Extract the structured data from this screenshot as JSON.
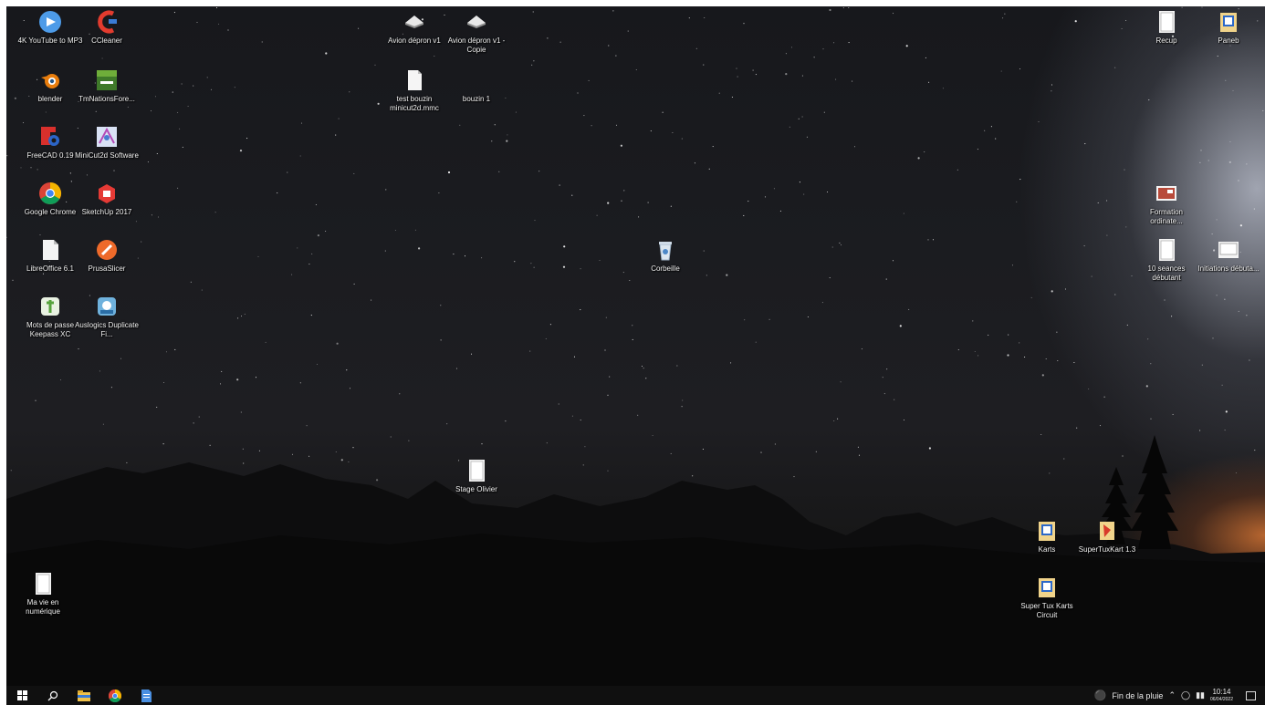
{
  "desktop": {
    "icons": [
      {
        "label": "4K YouTube to MP3",
        "icon": "youtube-mp3-icon"
      },
      {
        "label": "CCleaner",
        "icon": "ccleaner-icon"
      },
      {
        "label": "blender",
        "icon": "blender-icon"
      },
      {
        "label": "TmNationsFore...",
        "icon": "trackmania-icon"
      },
      {
        "label": "FreeCAD 0.19",
        "icon": "freecad-icon"
      },
      {
        "label": "MiniCut2d Software",
        "icon": "minicut2d-icon"
      },
      {
        "label": "Google Chrome",
        "icon": "chrome-icon"
      },
      {
        "label": "SketchUp 2017",
        "icon": "sketchup-icon"
      },
      {
        "label": "LibreOffice 6.1",
        "icon": "libreoffice-icon"
      },
      {
        "label": "PrusaSlicer",
        "icon": "prusaslicer-icon"
      },
      {
        "label": "Mots de passe Keepass XC",
        "icon": "keepassxc-icon"
      },
      {
        "label": "Auslogics Duplicate Fi...",
        "icon": "auslogics-icon"
      },
      {
        "label": "Avion dépron v1",
        "icon": "dxf-file-icon"
      },
      {
        "label": "Avion dépron v1 - Copie",
        "icon": "dxf-file-icon"
      },
      {
        "label": "test bouzin minicut2d.mmc",
        "icon": "file-icon"
      },
      {
        "label": "bouzin 1",
        "icon": "blank-icon"
      },
      {
        "label": "Corbeille",
        "icon": "recycle-bin-icon"
      },
      {
        "label": "Stage Olivier",
        "icon": "document-icon"
      },
      {
        "label": "Ma vie en numérique",
        "icon": "document-icon"
      },
      {
        "label": "Recup",
        "icon": "document-icon"
      },
      {
        "label": "Paneb",
        "icon": "folder-doc-icon"
      },
      {
        "label": "Formation ordinate...",
        "icon": "presentation-icon"
      },
      {
        "label": "10 seances débutant",
        "icon": "document-icon"
      },
      {
        "label": "Initiations débuta...",
        "icon": "presentation-blank-icon"
      },
      {
        "label": "Karts",
        "icon": "folder-doc-icon"
      },
      {
        "label": "SuperTuxKart 1.3",
        "icon": "supertuxkart-icon"
      },
      {
        "label": "Super Tux Karts Circuit",
        "icon": "folder-doc-icon"
      }
    ]
  },
  "taskbar": {
    "apps": [
      {
        "name": "start-button",
        "icon": "windows-icon"
      },
      {
        "name": "search-button",
        "icon": "search-icon"
      },
      {
        "name": "file-explorer-button",
        "icon": "folder-icon"
      },
      {
        "name": "chrome-taskbar-button",
        "icon": "chrome-icon"
      },
      {
        "name": "document-taskbar-button",
        "icon": "document-icon"
      }
    ],
    "weather": "Fin de la pluie",
    "time": "10:14",
    "date": "06/04/2022"
  },
  "colors": {
    "taskbar_bg": "#101010",
    "label_text": "#f2f2f2",
    "horizon_glow": "#c86e32"
  }
}
